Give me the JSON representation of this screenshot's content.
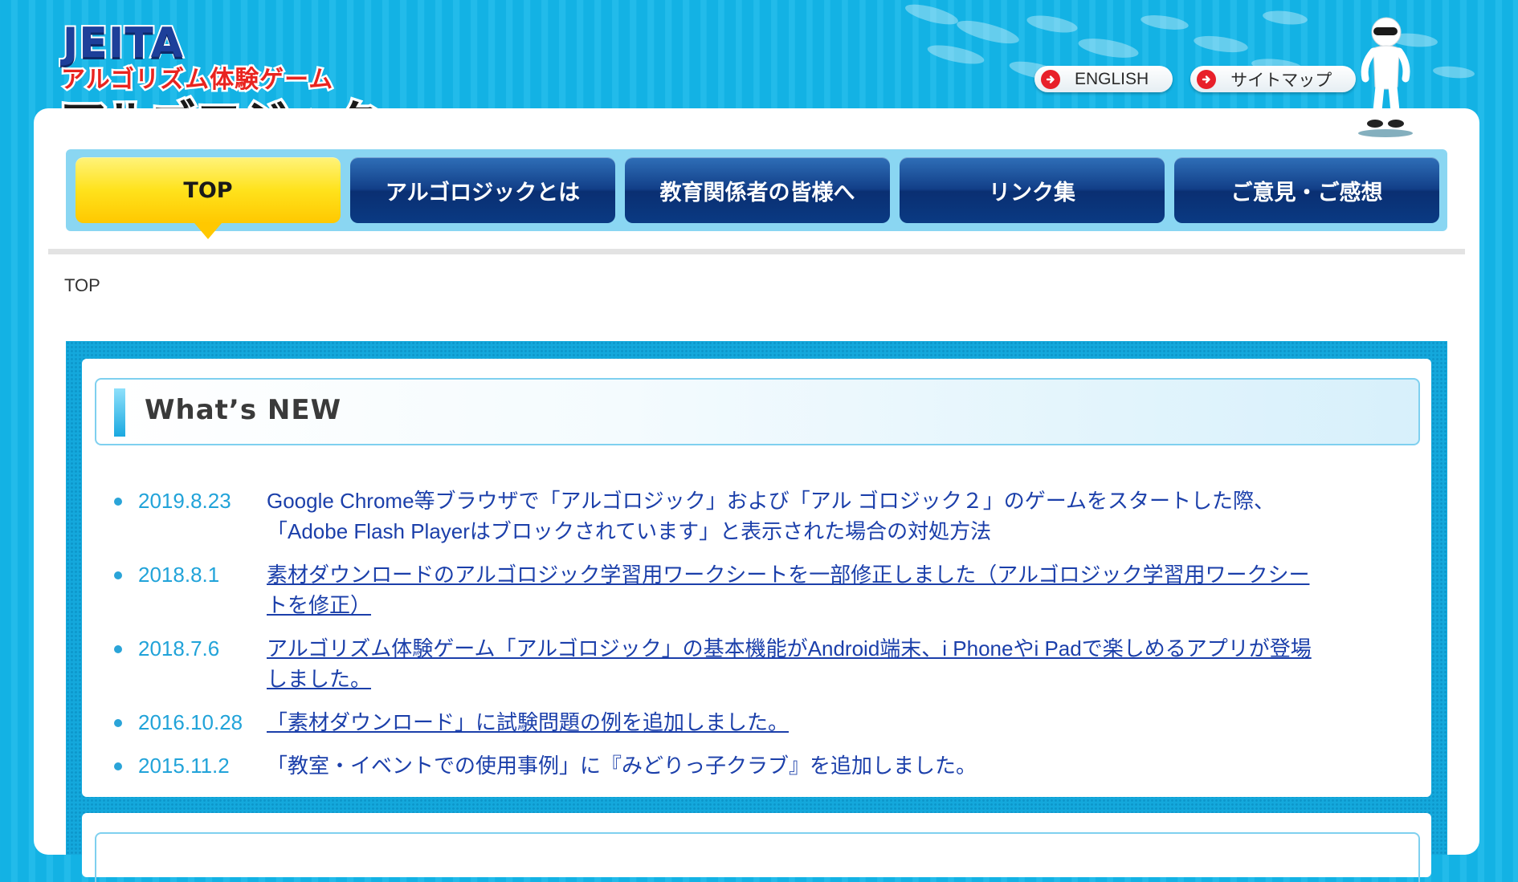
{
  "logo": {
    "brand": "JEITA",
    "subtitle": "アルゴリズム体験ゲーム",
    "title": "アルゴロジック"
  },
  "header": {
    "links": [
      {
        "label": "ENGLISH"
      },
      {
        "label": "サイトマップ"
      }
    ]
  },
  "nav": {
    "items": [
      {
        "label": "TOP"
      },
      {
        "label": "アルゴロジックとは"
      },
      {
        "label": "教育関係者の皆様へ"
      },
      {
        "label": "リンク集"
      },
      {
        "label": "ご意見・ご感想"
      }
    ],
    "active_index": 0
  },
  "breadcrumb": "TOP",
  "news": {
    "heading": "What’s NEW",
    "items": [
      {
        "date": "2019.8.23",
        "text": "Google Chrome等ブラウザで「アルゴロジック」および「アル ゴロジック２」のゲームをスタートした際、「Adobe Flash Playerはブロックされています」と表示された場合の対処方法"
      },
      {
        "date": "2018.8.1",
        "text": "素材ダウンロードのアルゴロジック学習用ワークシートを一部修正しました（アルゴロジック学習用ワークシートを修正）"
      },
      {
        "date": "2018.7.6",
        "text": "アルゴリズム体験ゲーム「アルゴロジック」の基本機能がAndroid端末、i Phoneやi Padで楽しめるアプリが登場しました。"
      },
      {
        "date": "2016.10.28",
        "text": "「素材ダウンロード」に試験問題の例を追加しました。"
      },
      {
        "date": "2015.11.2",
        "text": "「教室・イベントでの使用事例」に『みどりっ子クラブ』を追加しました。"
      }
    ]
  },
  "colors": {
    "background": "#13b2e4",
    "nav_active": "#ffe21c",
    "nav_inactive": "#123f88",
    "date": "#21a3d9",
    "link": "#1b3faa"
  },
  "icons": [
    "arrow-right-icon",
    "mascot-icon"
  ]
}
